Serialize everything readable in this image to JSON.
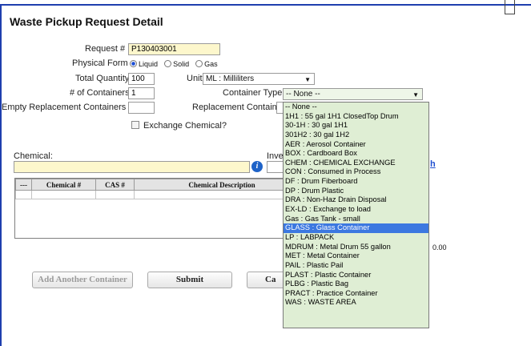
{
  "page": {
    "title": "Waste Pickup Request Detail"
  },
  "form": {
    "request_label": "Request #",
    "request_value": "P130403001",
    "physical_form_label": "Physical Form",
    "physical_form_options": [
      "Liquid",
      "Solid",
      "Gas"
    ],
    "physical_form_selected": "Liquid",
    "total_quantity_label": "Total Quantity",
    "total_quantity_value": "100",
    "unit_label": "Unit",
    "unit_value": "ML : Milliliters",
    "containers_label": "# of Containers",
    "containers_value": "1",
    "container_type_label": "Container Type",
    "container_type_value": "-- None --",
    "empty_replacement_label": "Empty Replacement Containers",
    "replacement_containers_label": "Replacement Containers",
    "exchange_chemical_label": "Exchange Chemical?"
  },
  "chemical": {
    "label": "Chemical:",
    "inventory_label_partial": "Inve",
    "link_partial": "h",
    "amount": "0.00"
  },
  "grid": {
    "columns": [
      "---",
      "Chemical #",
      "CAS #",
      "Chemical Description"
    ]
  },
  "buttons": {
    "add_container": "Add Another Container",
    "submit": "Submit",
    "cancel_partial": "Ca"
  },
  "dropdown": {
    "selected": "GLASS : Glass Container",
    "options": [
      "-- None --",
      "1H1 : 55 gal 1H1 ClosedTop Drum",
      "30-1H : 30 gal 1H1",
      "301H2 : 30 gal 1H2",
      "AER : Aerosol Container",
      "BOX : Cardboard Box",
      "CHEM : CHEMICAL EXCHANGE",
      "CON : Consumed in Process",
      "DF : Drum Fiberboard",
      "DP : Drum Plastic",
      "DRA : Non-Haz Drain Disposal",
      "EX-LD : Exchange to load",
      "Gas : Gas Tank - small",
      "GLASS : Glass Container",
      "LP : LABPACK",
      "MDRUM : Metal Drum 55 gallon",
      "MET : Metal Container",
      "PAIL : Plastic Pail",
      "PLAST : Plastic Container",
      "PLBG : Plastic Bag",
      "PRACT : Practice Container",
      "WAS : WASTE AREA"
    ]
  }
}
